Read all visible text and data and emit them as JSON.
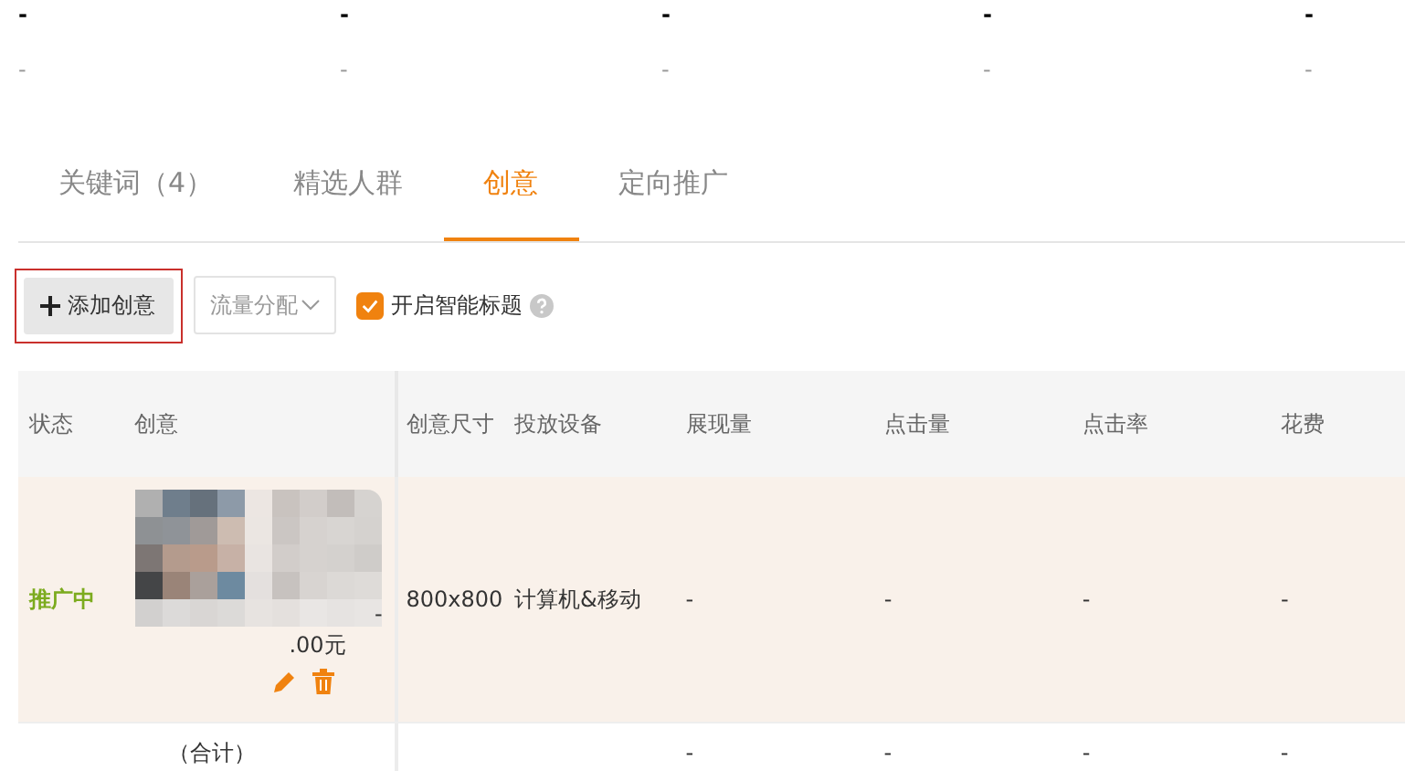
{
  "summary": [
    {
      "value": "-",
      "sub": "-"
    },
    {
      "value": "-",
      "sub": "-"
    },
    {
      "value": "-",
      "sub": "-"
    },
    {
      "value": "-",
      "sub": "-"
    },
    {
      "value": "-",
      "sub": "-"
    }
  ],
  "tabs": [
    {
      "label": "关键词（4）",
      "selected": false
    },
    {
      "label": "精选人群",
      "selected": false
    },
    {
      "label": "创意",
      "selected": true
    },
    {
      "label": "定向推广",
      "selected": false
    }
  ],
  "toolbar": {
    "add_button": {
      "label": "添加创意",
      "highlighted": true
    },
    "traffic_dropdown": "流量分配",
    "smart_title": {
      "label": "开启智能标题",
      "checked": true
    }
  },
  "table": {
    "columns": [
      "状态",
      "创意",
      "创意尺寸",
      "投放设备",
      "展现量",
      "点击量",
      "点击率",
      "花费"
    ],
    "rows": [
      {
        "status": "推广中",
        "creative": {
          "kind": "picture",
          "title_tail": "-",
          "price": ".00元"
        },
        "size": "800x800",
        "device": "计算机&移动",
        "impressions": "-",
        "clicks": "-",
        "ctr": "-",
        "cost": "-"
      }
    ],
    "total": {
      "label": "（合计）",
      "impressions": "-",
      "clicks": "-",
      "ctr": "-",
      "cost": "-"
    }
  }
}
